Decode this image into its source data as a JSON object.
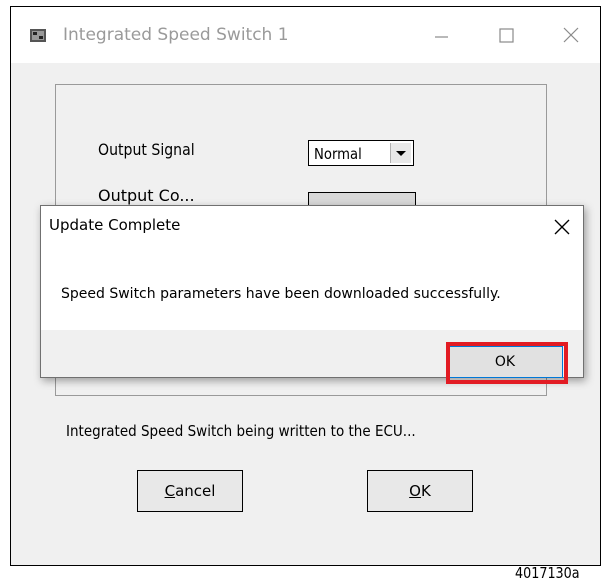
{
  "window": {
    "title": "Integrated Speed Switch 1",
    "icon": "app-window-icon"
  },
  "form": {
    "output_signal_label": "Output Signal",
    "output_signal_value": "Normal",
    "output_second_label": "Output Co..."
  },
  "status_text": "Integrated Speed Switch being written to the ECU...",
  "buttons": {
    "cancel_label_underlined": "C",
    "cancel_label_rest": "ancel",
    "ok_label_underlined": "O",
    "ok_label_rest": "K"
  },
  "dialog": {
    "title": "Update Complete",
    "message": "Speed Switch parameters have been downloaded successfully.",
    "ok_label": "OK"
  },
  "caption": "4017130a",
  "colors": {
    "highlight": "#e21b23",
    "focus_border": "#0078d7"
  }
}
